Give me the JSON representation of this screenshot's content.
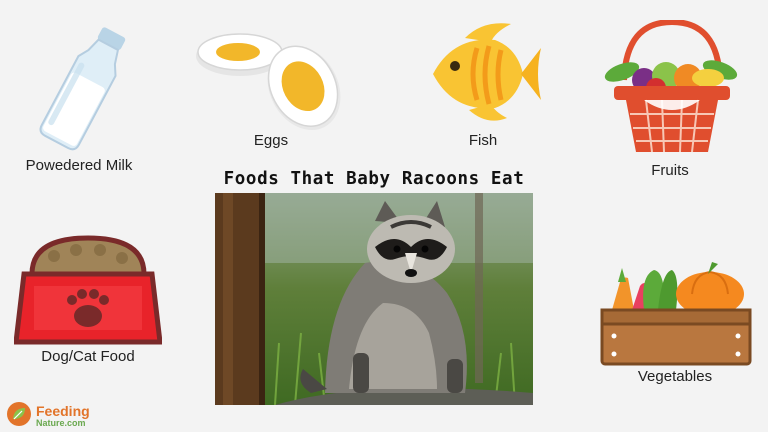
{
  "title": "Foods That Baby Racoons Eat",
  "items": {
    "milk": "Powedered Milk",
    "eggs": "Eggs",
    "fish": "Fish",
    "fruits": "Fruits",
    "petfood": "Dog/Cat Food",
    "vegetables": "Vegetables"
  },
  "logo": {
    "line1": "Feeding",
    "line2": "Nature.com"
  },
  "colors": {
    "background": "#f3f3f3",
    "fish": "#f9c433",
    "bowl": "#e8232a",
    "basket": "#e04e2e",
    "crate": "#b9773f"
  }
}
